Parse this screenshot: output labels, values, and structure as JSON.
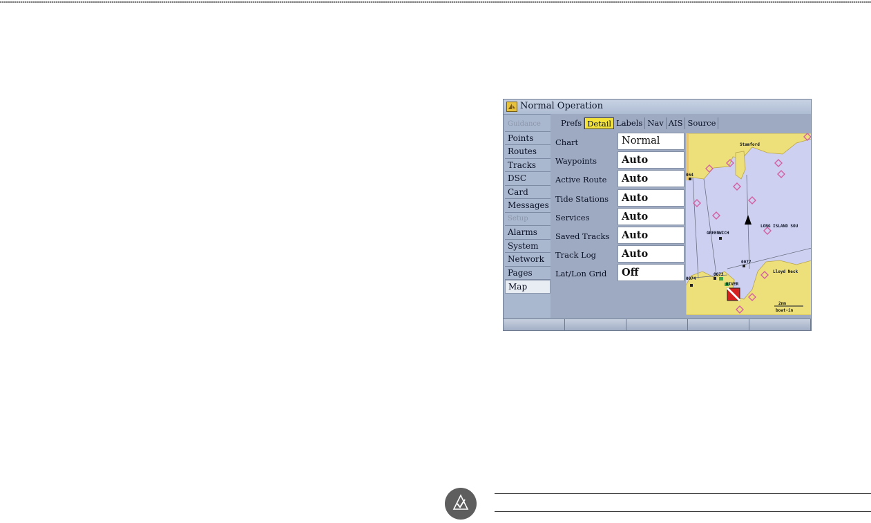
{
  "window": {
    "title": "Normal Operation"
  },
  "sidebar": {
    "items": [
      {
        "label": "Guidance",
        "state": "dim"
      },
      {
        "label": "Points",
        "state": "normal"
      },
      {
        "label": "Routes",
        "state": "normal"
      },
      {
        "label": "Tracks",
        "state": "normal"
      },
      {
        "label": "DSC",
        "state": "normal"
      },
      {
        "label": "Card",
        "state": "normal"
      },
      {
        "label": "Messages",
        "state": "normal"
      },
      {
        "label": "Setup",
        "state": "dim"
      },
      {
        "label": "Alarms",
        "state": "normal"
      },
      {
        "label": "System",
        "state": "normal"
      },
      {
        "label": "Network",
        "state": "normal"
      },
      {
        "label": "Pages",
        "state": "normal"
      },
      {
        "label": "Map",
        "state": "selected"
      }
    ]
  },
  "tabs": [
    {
      "label": "Prefs",
      "active": false
    },
    {
      "label": "Detail",
      "active": true
    },
    {
      "label": "Labels",
      "active": false
    },
    {
      "label": "Nav",
      "active": false
    },
    {
      "label": "AIS",
      "active": false
    },
    {
      "label": "Source",
      "active": false
    }
  ],
  "settings": [
    {
      "label": "Chart",
      "value": "Normal"
    },
    {
      "label": "Waypoints",
      "value": "Auto"
    },
    {
      "label": "Active Route",
      "value": "Auto"
    },
    {
      "label": "Tide Stations",
      "value": "Auto"
    },
    {
      "label": "Services",
      "value": "Auto"
    },
    {
      "label": "Saved Tracks",
      "value": "Auto"
    },
    {
      "label": "Track Log",
      "value": "Auto"
    },
    {
      "label": "Lat/Lon Grid",
      "value": "Off"
    }
  ],
  "map": {
    "labels": {
      "stamford": "Stamford",
      "long_island_sound": "LONG ISLAND SOU",
      "greenwich": "GREENWICH",
      "lloyd_neck": "Lloyd Neck",
      "scale": "2nm",
      "scale_sub": "boat-in",
      "wp_064": "064",
      "wp_073": "0073",
      "wp_074": "0074",
      "wp_077": "0077",
      "river": "RIVER"
    },
    "colors": {
      "water": "#cdd0f0",
      "land": "#ede07a",
      "hazard": "#d35ea2",
      "route": "#6a6f80"
    }
  },
  "softkeys": [
    "",
    "",
    "",
    "",
    ""
  ],
  "icons": [
    "app-icon",
    "north-arrow-icon",
    "dive-flag-icon",
    "note-icon"
  ]
}
